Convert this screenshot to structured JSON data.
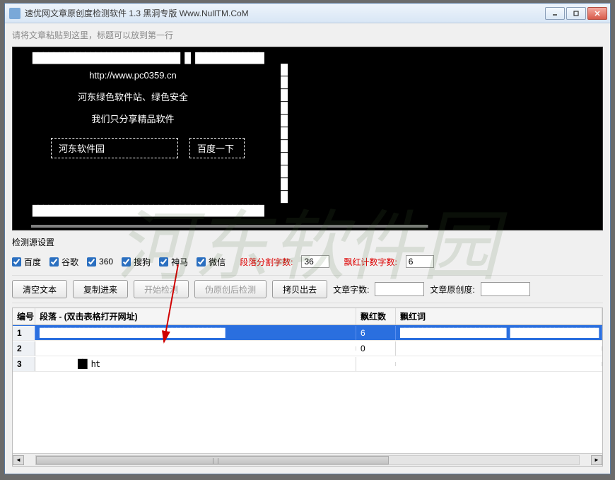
{
  "window": {
    "title": "速优网文章原创度检测软件 1.3   黑洞专版 Www.NullTM.CoM"
  },
  "editor": {
    "placeholder": "请将文章粘贴到这里，标题可以放到第一行",
    "url": "http://www.pc0359.cn",
    "line1": "河东绿色软件站、绿色安全",
    "line2": "我们只分享精品软件",
    "box1": "河东软件园",
    "box2": "百度一下"
  },
  "source_label": "检测源设置",
  "checkboxes": {
    "baidu": "百度",
    "google": "谷歌",
    "s360": "360",
    "sogou": "搜狗",
    "shenma": "神马",
    "weixin": "微信"
  },
  "params": {
    "segment_label": "段落分割字数:",
    "segment_value": "36",
    "redcount_label": "飘红计数字数:",
    "redcount_value": "6"
  },
  "buttons": {
    "clear": "清空文本",
    "copyin": "复制进来",
    "start": "开始检测",
    "fake": "伪原创后检测",
    "copyout": "拷贝出去"
  },
  "stats": {
    "wordcount_label": "文章字数:",
    "wordcount_value": "",
    "original_label": "文章原创度:",
    "original_value": ""
  },
  "table": {
    "headers": {
      "num": "编号",
      "para": "段落 - (双击表格打开网址)",
      "red": "飘红数",
      "redw": "飘红词"
    },
    "rows": [
      {
        "num": "1",
        "para": "██████████████████████████████████████████",
        "red": "6",
        "redw": "████████████████████████ ████████████████████ ██████"
      },
      {
        "num": "2",
        "para": "",
        "red": "0",
        "redw": ""
      },
      {
        "num": "3",
        "para": "██             ht",
        "red": "",
        "redw": ""
      }
    ]
  },
  "watermark": "河东软件园"
}
